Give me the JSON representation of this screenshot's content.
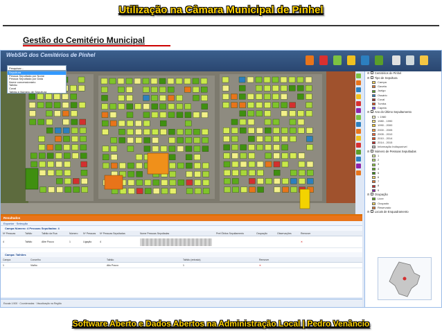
{
  "slide": {
    "title": "Utilização na Câmara Municipal de Pinhel",
    "subtitle": "Gestão do Cemitério Municipal",
    "footer": "Software Aberto e Dados Abertos na Administração Local   |   Pedro Venâncio"
  },
  "app": {
    "logo": "WebSIG dos Cemitérios de Pinhel",
    "layer_select": {
      "value": "Pesquisar..."
    },
    "layer_menu": [
      "Sepultura",
      "Pessoa Sepultada por Nome",
      "Pessoa Sepultada por Data",
      "Nome concessionário",
      "Talhão",
      "Coval",
      "Talhão e Número de Sepultura",
      "Talhão e Número de Ossário"
    ],
    "results": {
      "header": "Resultados",
      "tabs": "Exportar  ·  Selecção",
      "section1": "Campa Número: 4 Pessoas Sepultadas: 4",
      "grid1_headers": [
        "Nº Pessoas",
        "Talhão",
        "Talhão da Rua",
        "Número",
        "Nº Pessoas",
        "Nº Pessoas Sepultadas",
        "Nome Pessoas Sepultadas",
        "Pref.Óbitos Sepultamento",
        "Ocupação",
        "Observações",
        "Remover"
      ],
      "grid1_row": [
        "4",
        "Talhão",
        "Alhe Pouco",
        "1",
        "Ligação",
        "4",
        "",
        "",
        "",
        "",
        ""
      ],
      "section2": "Campa: Talhões",
      "grid2_headers": [
        "Campa",
        "Concelho",
        "Talhão",
        "Talhão (entrada)",
        "Remover"
      ],
      "grid2_row": [
        "1",
        "Vialho",
        "Alto Pouco",
        "1",
        ""
      ]
    },
    "statusbar": "Escala 1:500   ·   Coordenadas   ·   Visualização na Região"
  },
  "legend": {
    "groups": [
      {
        "title": "Cemitérios de Pinhel",
        "items": []
      },
      {
        "title": "Tipo de Sepultura",
        "items": [
          {
            "label": "Campa",
            "color": "#f4d35e"
          },
          {
            "label": "Gaveta",
            "color": "#e07b39"
          },
          {
            "label": "Jazigo",
            "color": "#5a9e2a"
          },
          {
            "label": "Ossário",
            "color": "#2f7fbf"
          },
          {
            "label": "Coval",
            "color": "#9b2c2c"
          },
          {
            "label": "Tumba",
            "color": "#e64a19"
          },
          {
            "label": "Capela",
            "color": "#7c4dff"
          }
        ]
      },
      {
        "title": "Ano do Último Sepultamento",
        "items": [
          {
            "label": "< 1980",
            "color": "#ffffcc"
          },
          {
            "label": "1980 - 1990",
            "color": "#ffe680"
          },
          {
            "label": "1990 - 2000",
            "color": "#ffcc33"
          },
          {
            "label": "2000 - 2005",
            "color": "#ff9933"
          },
          {
            "label": "2005 - 2010",
            "color": "#ff6633"
          },
          {
            "label": "2010 - 2014",
            "color": "#e64a19"
          },
          {
            "label": "2014 - 2015",
            "color": "#c62828"
          },
          {
            "label": "Informação Indisponível",
            "color": "#bdbdbd"
          }
        ]
      },
      {
        "title": "Número de Pessoas Sepultadas",
        "items": [
          {
            "label": "1",
            "color": "#dff5a1"
          },
          {
            "label": "2",
            "color": "#b8e06b"
          },
          {
            "label": "3",
            "color": "#8fcb3b"
          },
          {
            "label": "4",
            "color": "#5fae1f"
          },
          {
            "label": "5",
            "color": "#3a8f12"
          },
          {
            "label": "6",
            "color": "#f4d35e"
          },
          {
            "label": "7",
            "color": "#e07b39"
          },
          {
            "label": "8",
            "color": "#c62828"
          },
          {
            "label": "9",
            "color": "#8e24aa"
          }
        ]
      },
      {
        "title": "Ocupação",
        "items": [
          {
            "label": "Livre",
            "color": "#5fae1f"
          },
          {
            "label": "Ocupado",
            "color": "#f4d35e"
          },
          {
            "label": "Reservado",
            "color": "#e07b39"
          }
        ]
      },
      {
        "title": "Locais de Enquadramento",
        "items": []
      }
    ]
  },
  "colors": {
    "title_yellow": "#ffd200",
    "results_orange": "#e8741a",
    "app_frame": "#dfe8f6"
  }
}
